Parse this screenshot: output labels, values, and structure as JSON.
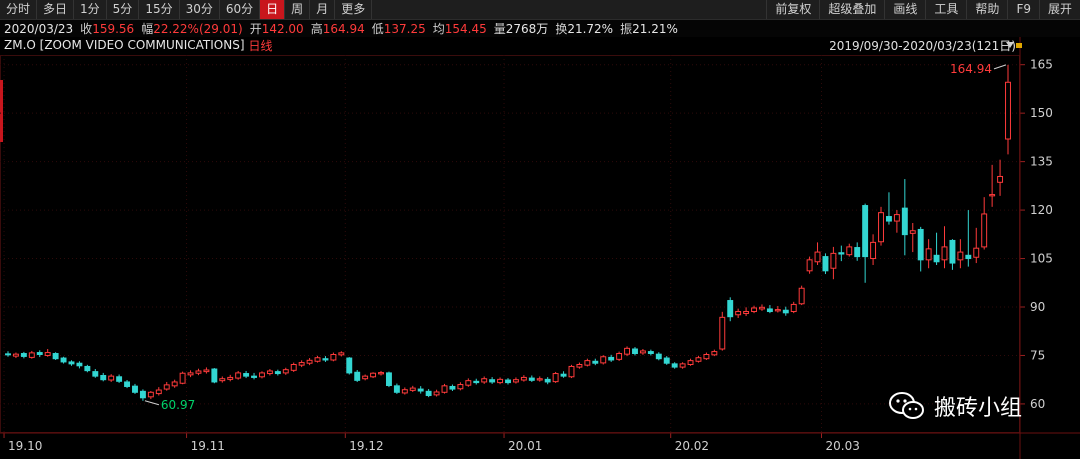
{
  "toolbar": {
    "periods": [
      {
        "label": "分时",
        "active": false
      },
      {
        "label": "多日",
        "active": false
      },
      {
        "label": "1分",
        "active": false
      },
      {
        "label": "5分",
        "active": false
      },
      {
        "label": "15分",
        "active": false
      },
      {
        "label": "30分",
        "active": false
      },
      {
        "label": "60分",
        "active": false
      },
      {
        "label": "日",
        "active": true
      },
      {
        "label": "周",
        "active": false
      },
      {
        "label": "月",
        "active": false
      },
      {
        "label": "更多",
        "active": false
      }
    ],
    "right": [
      "前复权",
      "超级叠加",
      "画线",
      "工具",
      "帮助",
      "F9",
      "展开"
    ]
  },
  "quote": {
    "date": "2020/03/23",
    "close_label": "收",
    "close": "159.56",
    "change_label": "幅",
    "change": "22.22%(29.01)",
    "open_label": "开",
    "open": "142.00",
    "high_label": "高",
    "high": "164.94",
    "low_label": "低",
    "low": "137.25",
    "avg_label": "均",
    "avg": "154.45",
    "volume_label": "量",
    "volume": "2768万",
    "turnover_label": "换",
    "turnover": "21.72%",
    "amplitude_label": "振",
    "amplitude": "21.21%"
  },
  "title": {
    "symbol": "ZM.O [ZOOM VIDEO COMMUNICATIONS]",
    "period": "日线",
    "range": "2019/09/30-2020/03/23(121日)"
  },
  "watermark": "搬砖小组",
  "colors": {
    "up": "#ff3b3b",
    "down": "#33d6d2",
    "grid": "#2e0a0a",
    "accent": "#c8161d",
    "lowLabel": "#00d26a",
    "highLabel": "#ff3b3b"
  },
  "chart_data": {
    "type": "candlestick",
    "y_ticks": [
      60,
      75,
      90,
      105,
      120,
      135,
      150,
      165
    ],
    "ylim": [
      51,
      168
    ],
    "x_labels": [
      {
        "label": "19.10",
        "index": 0
      },
      {
        "label": "19.11",
        "index": 23
      },
      {
        "label": "19.12",
        "index": 43
      },
      {
        "label": "20.01",
        "index": 63
      },
      {
        "label": "20.02",
        "index": 84
      },
      {
        "label": "20.03",
        "index": 103
      }
    ],
    "annotations": {
      "high": "164.94",
      "low": "60.97"
    },
    "candles": [
      [
        75.5,
        75.2,
        76.3,
        74.6
      ],
      [
        74.8,
        75.4,
        75.9,
        74.2
      ],
      [
        75.6,
        74.7,
        76.1,
        74.1
      ],
      [
        74.4,
        75.8,
        76.4,
        74.0
      ],
      [
        75.9,
        75.3,
        76.6,
        74.5
      ],
      [
        75.0,
        75.9,
        77.0,
        74.6
      ],
      [
        75.6,
        74.0,
        76.0,
        73.6
      ],
      [
        74.2,
        73.0,
        74.6,
        72.5
      ],
      [
        73.0,
        72.4,
        73.5,
        71.8
      ],
      [
        72.6,
        71.8,
        73.2,
        71.0
      ],
      [
        71.6,
        70.3,
        72.1,
        69.8
      ],
      [
        70.0,
        68.6,
        70.8,
        68.1
      ],
      [
        68.8,
        67.5,
        69.6,
        67.0
      ],
      [
        67.4,
        68.6,
        69.2,
        66.8
      ],
      [
        68.4,
        67.0,
        69.1,
        66.5
      ],
      [
        66.8,
        65.4,
        67.4,
        64.9
      ],
      [
        65.5,
        63.6,
        66.2,
        63.1
      ],
      [
        63.9,
        61.9,
        64.5,
        60.97
      ],
      [
        62.2,
        63.6,
        64.0,
        61.5
      ],
      [
        63.2,
        64.3,
        65.2,
        62.6
      ],
      [
        64.6,
        65.9,
        66.8,
        64.1
      ],
      [
        65.6,
        66.8,
        67.5,
        65.0
      ],
      [
        66.4,
        69.5,
        70.0,
        66.1
      ],
      [
        69.0,
        69.6,
        70.4,
        68.3
      ],
      [
        69.5,
        70.2,
        70.9,
        68.9
      ],
      [
        70.0,
        70.5,
        71.3,
        69.4
      ],
      [
        70.8,
        66.8,
        71.1,
        66.4
      ],
      [
        67.2,
        67.8,
        68.5,
        66.6
      ],
      [
        67.6,
        68.2,
        69.0,
        67.0
      ],
      [
        68.0,
        69.6,
        70.2,
        67.5
      ],
      [
        69.4,
        68.6,
        70.2,
        68.0
      ],
      [
        68.6,
        68.2,
        69.6,
        67.6
      ],
      [
        68.4,
        69.6,
        70.1,
        67.9
      ],
      [
        69.4,
        70.2,
        70.8,
        68.8
      ],
      [
        70.0,
        69.4,
        70.6,
        68.8
      ],
      [
        69.6,
        70.6,
        71.2,
        69.0
      ],
      [
        70.4,
        72.2,
        72.8,
        69.9
      ],
      [
        72.0,
        72.8,
        73.5,
        71.4
      ],
      [
        72.6,
        73.5,
        74.2,
        72.0
      ],
      [
        73.2,
        74.3,
        74.9,
        72.8
      ],
      [
        74.0,
        73.6,
        74.8,
        73.0
      ],
      [
        73.6,
        75.3,
        75.9,
        73.2
      ],
      [
        75.2,
        75.8,
        76.3,
        74.7
      ],
      [
        74.2,
        69.6,
        74.5,
        69.1
      ],
      [
        69.8,
        67.3,
        70.5,
        66.8
      ],
      [
        67.8,
        68.6,
        69.1,
        67.3
      ],
      [
        68.4,
        69.5,
        69.8,
        68.0
      ],
      [
        69.3,
        69.7,
        70.2,
        68.8
      ],
      [
        69.6,
        65.7,
        70.0,
        65.2
      ],
      [
        65.6,
        63.6,
        66.3,
        63.1
      ],
      [
        63.4,
        64.4,
        65.1,
        62.9
      ],
      [
        64.2,
        64.9,
        65.6,
        63.7
      ],
      [
        64.6,
        64.0,
        65.5,
        63.2
      ],
      [
        63.9,
        62.6,
        64.6,
        62.1
      ],
      [
        62.8,
        63.7,
        64.4,
        62.3
      ],
      [
        63.6,
        65.6,
        66.2,
        63.2
      ],
      [
        65.4,
        64.6,
        66.0,
        64.0
      ],
      [
        64.7,
        66.0,
        66.7,
        64.2
      ],
      [
        65.8,
        67.2,
        67.9,
        65.3
      ],
      [
        67.0,
        66.6,
        67.8,
        66.0
      ],
      [
        66.8,
        67.8,
        68.5,
        66.2
      ],
      [
        67.5,
        66.8,
        68.3,
        66.2
      ],
      [
        66.6,
        67.6,
        68.2,
        66.1
      ],
      [
        67.4,
        66.6,
        68.0,
        66.0
      ],
      [
        66.8,
        67.5,
        68.2,
        66.3
      ],
      [
        67.4,
        68.2,
        68.9,
        66.9
      ],
      [
        68.0,
        67.3,
        68.8,
        66.8
      ],
      [
        67.4,
        67.8,
        68.5,
        66.9
      ],
      [
        67.6,
        66.8,
        68.3,
        66.1
      ],
      [
        66.9,
        69.4,
        69.9,
        66.5
      ],
      [
        69.2,
        68.6,
        70.1,
        68.1
      ],
      [
        68.4,
        71.6,
        72.1,
        68.0
      ],
      [
        71.4,
        72.2,
        72.8,
        70.9
      ],
      [
        72.0,
        73.4,
        74.0,
        71.6
      ],
      [
        73.2,
        72.6,
        74.0,
        72.0
      ],
      [
        72.7,
        74.6,
        75.1,
        72.2
      ],
      [
        74.4,
        73.6,
        75.2,
        73.0
      ],
      [
        73.8,
        75.6,
        76.2,
        73.3
      ],
      [
        75.4,
        77.2,
        77.8,
        74.8
      ],
      [
        77.0,
        75.6,
        77.6,
        75.0
      ],
      [
        75.8,
        76.4,
        77.0,
        75.2
      ],
      [
        76.2,
        75.6,
        76.8,
        75.0
      ],
      [
        75.4,
        74.0,
        76.0,
        73.5
      ],
      [
        74.2,
        72.6,
        74.8,
        72.1
      ],
      [
        72.4,
        71.4,
        72.9,
        70.9
      ],
      [
        71.4,
        72.4,
        72.9,
        70.9
      ],
      [
        72.2,
        73.4,
        74.0,
        71.8
      ],
      [
        73.2,
        74.3,
        74.9,
        72.8
      ],
      [
        74.0,
        75.3,
        75.9,
        73.6
      ],
      [
        75.2,
        76.2,
        76.8,
        74.8
      ],
      [
        77.0,
        86.8,
        88.5,
        76.5
      ],
      [
        92.0,
        87.0,
        93.0,
        85.6
      ],
      [
        87.6,
        88.6,
        89.5,
        86.6
      ],
      [
        88.0,
        88.6,
        89.9,
        87.2
      ],
      [
        88.6,
        89.7,
        90.4,
        88.1
      ],
      [
        89.4,
        89.9,
        90.8,
        88.8
      ],
      [
        89.4,
        88.6,
        90.6,
        88.1
      ],
      [
        88.8,
        89.2,
        90.3,
        88.3
      ],
      [
        89.0,
        88.2,
        90.1,
        87.3
      ],
      [
        88.6,
        90.8,
        91.6,
        88.1
      ],
      [
        91.0,
        95.8,
        96.6,
        90.6
      ],
      [
        101.2,
        104.6,
        105.6,
        100.3
      ],
      [
        104.0,
        107.0,
        110.0,
        103.0
      ],
      [
        105.6,
        101.2,
        106.6,
        100.2
      ],
      [
        102.0,
        106.6,
        108.6,
        98.6
      ],
      [
        106.8,
        106.4,
        109.0,
        104.2
      ],
      [
        106.2,
        108.6,
        109.6,
        105.6
      ],
      [
        108.4,
        105.6,
        110.0,
        104.3
      ],
      [
        121.4,
        105.6,
        122.0,
        97.5
      ],
      [
        105.0,
        110.0,
        112.5,
        103.0
      ],
      [
        110.2,
        119.2,
        121.0,
        109.0
      ],
      [
        118.0,
        116.6,
        125.5,
        115.5
      ],
      [
        116.6,
        118.6,
        120.0,
        113.0
      ],
      [
        120.6,
        112.4,
        129.6,
        106.0
      ],
      [
        112.8,
        113.6,
        116.0,
        107.0
      ],
      [
        114.0,
        104.6,
        114.8,
        101.0
      ],
      [
        104.6,
        108.0,
        111.0,
        102.0
      ],
      [
        106.0,
        104.0,
        113.0,
        103.0
      ],
      [
        104.6,
        108.6,
        115.0,
        102.0
      ],
      [
        110.6,
        103.6,
        111.0,
        101.5
      ],
      [
        104.6,
        107.0,
        111.0,
        102.0
      ],
      [
        106.0,
        105.0,
        120.0,
        102.5
      ],
      [
        105.4,
        108.2,
        114.5,
        103.6
      ],
      [
        108.6,
        118.8,
        124.0,
        107.8
      ],
      [
        124.4,
        124.8,
        134.0,
        121.0
      ],
      [
        128.6,
        130.4,
        135.6,
        124.4
      ],
      [
        142.0,
        159.56,
        164.94,
        137.25
      ]
    ]
  }
}
